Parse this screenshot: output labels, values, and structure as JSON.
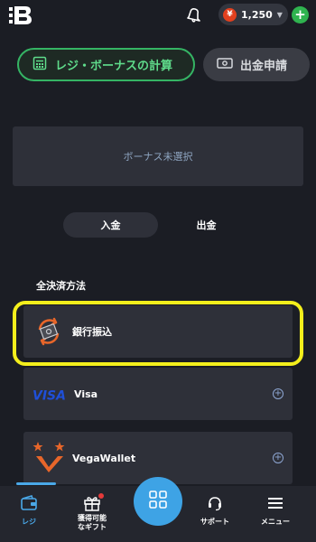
{
  "balance": {
    "currency_symbol": "¥",
    "amount": "1,250"
  },
  "actions": {
    "calc_label": "レジ・ボーナスの計算",
    "withdraw_label": "出金申請"
  },
  "bonus": {
    "label": "ボーナス未選択"
  },
  "tabs": {
    "deposit": "入金",
    "withdraw": "出金"
  },
  "payment": {
    "section_title": "全決済方法",
    "methods": [
      {
        "name": "銀行振込",
        "icon": "bank-transfer-icon"
      },
      {
        "name": "Visa",
        "icon": "visa-logo"
      },
      {
        "name": "VegaWallet",
        "icon": "vegawallet-logo"
      }
    ]
  },
  "nav": {
    "items": [
      {
        "label": "レジ",
        "icon": "wallet-icon"
      },
      {
        "label": "獲得可能\nなギフト",
        "icon": "gift-icon"
      },
      {
        "label": "",
        "icon": "grid-icon"
      },
      {
        "label": "サポート",
        "icon": "headset-icon"
      },
      {
        "label": "メニュー",
        "icon": "menu-icon"
      }
    ]
  },
  "colors": {
    "accent_green": "#35b464",
    "accent_blue": "#3ea3e5",
    "highlight": "#f4ef1c"
  }
}
